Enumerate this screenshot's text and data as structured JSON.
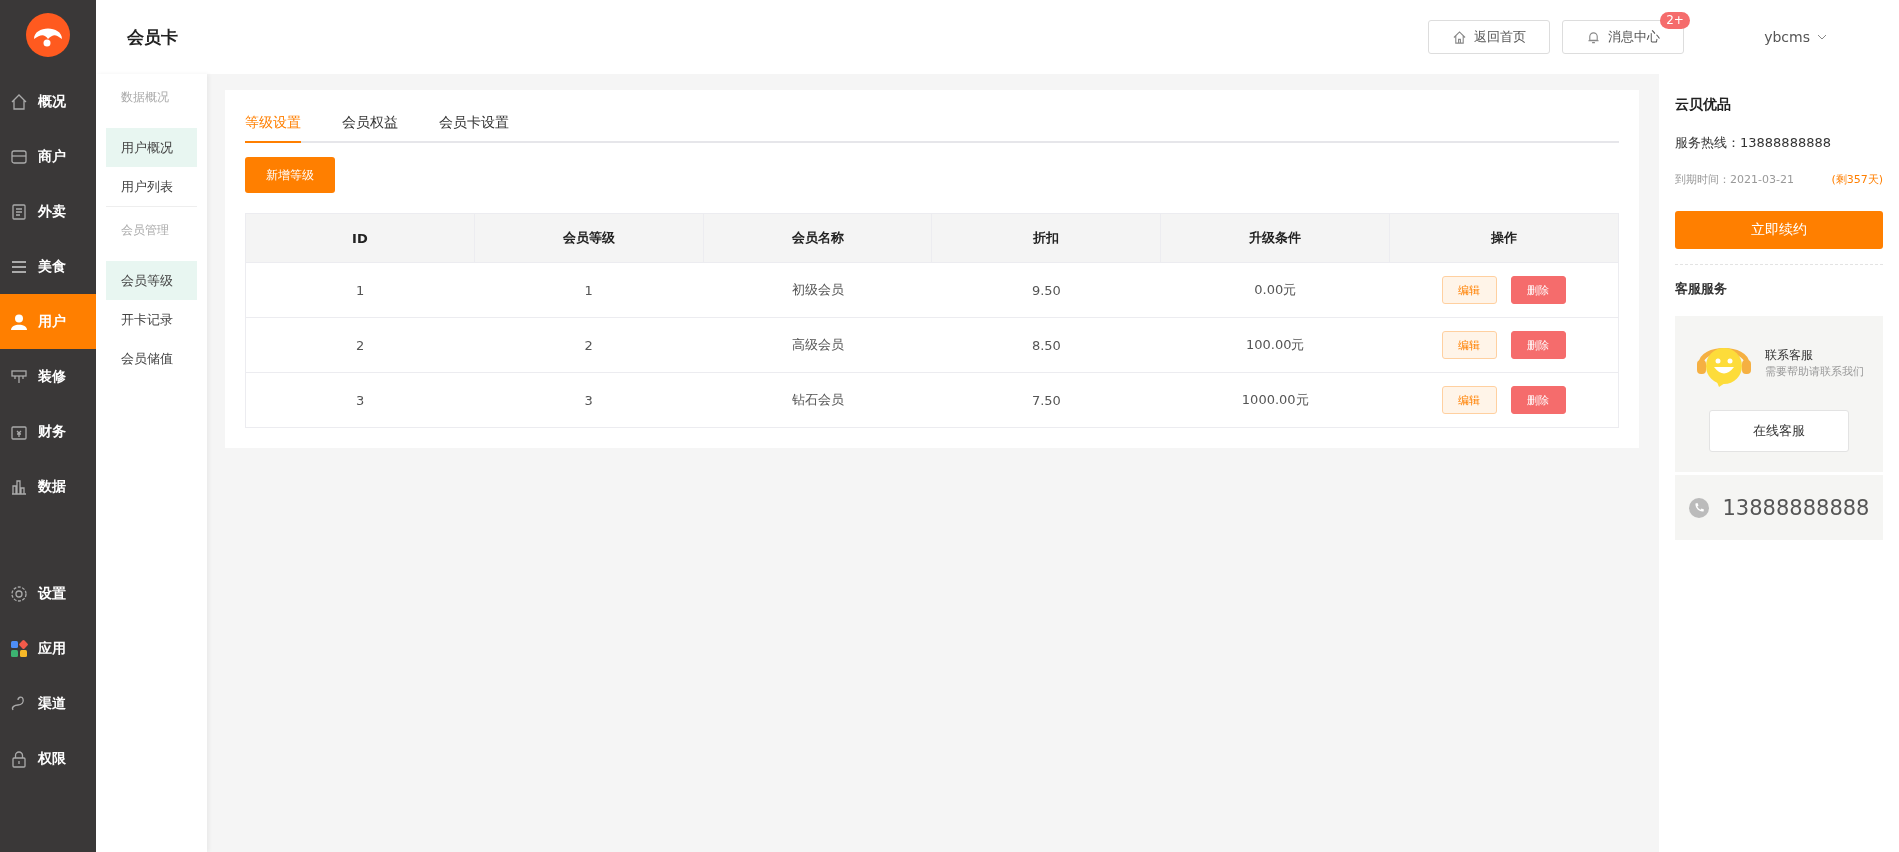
{
  "header": {
    "title": "会员卡",
    "home_button": "返回首页",
    "message_button": "消息中心",
    "message_badge": "2+",
    "user": "ybcms"
  },
  "nav": {
    "top": [
      {
        "label": "概况",
        "selected": false
      },
      {
        "label": "商户",
        "selected": false
      },
      {
        "label": "外卖",
        "selected": false
      },
      {
        "label": "美食",
        "selected": false
      },
      {
        "label": "用户",
        "selected": true
      },
      {
        "label": "装修",
        "selected": false
      },
      {
        "label": "财务",
        "selected": false
      },
      {
        "label": "数据",
        "selected": false
      }
    ],
    "bottom": [
      {
        "label": "设置",
        "selected": false
      },
      {
        "label": "应用",
        "selected": false
      },
      {
        "label": "渠道",
        "selected": false
      },
      {
        "label": "权限",
        "selected": false
      }
    ]
  },
  "subnav": [
    {
      "heading": "数据概况",
      "items": [
        {
          "label": "用户概况",
          "selected": true
        },
        {
          "label": "用户列表",
          "selected": false
        }
      ]
    },
    {
      "heading": "会员管理",
      "items": [
        {
          "label": "会员等级",
          "selected": true
        },
        {
          "label": "开卡记录",
          "selected": false
        },
        {
          "label": "会员储值",
          "selected": false
        }
      ]
    }
  ],
  "tabs": [
    {
      "label": "等级设置",
      "selected": true
    },
    {
      "label": "会员权益",
      "selected": false
    },
    {
      "label": "会员卡设置",
      "selected": false
    }
  ],
  "add_button": "新增等级",
  "table": {
    "columns": [
      "ID",
      "会员等级",
      "会员名称",
      "折扣",
      "升级条件",
      "操作"
    ],
    "rows": [
      {
        "cells": [
          "1",
          "1",
          "初级会员",
          "9.50",
          "0.00元"
        ],
        "actions": [
          "编辑",
          "删除"
        ]
      },
      {
        "cells": [
          "2",
          "2",
          "高级会员",
          "8.50",
          "100.00元"
        ],
        "actions": [
          "编辑",
          "删除"
        ]
      },
      {
        "cells": [
          "3",
          "3",
          "钻石会员",
          "7.50",
          "1000.00元"
        ],
        "actions": [
          "编辑",
          "删除"
        ]
      }
    ]
  },
  "side_panel": {
    "brand": "云贝优品",
    "hotline": "服务热线：13888888888",
    "expiry": "到期时间：2021-03-21",
    "remaining": "(剩357天)",
    "renew_button": "立即续约",
    "service_title": "客服服务",
    "contact_title": "联系客服",
    "contact_hint": "需要帮助请联系我们",
    "online_button": "在线客服",
    "phone": "13888888888"
  }
}
